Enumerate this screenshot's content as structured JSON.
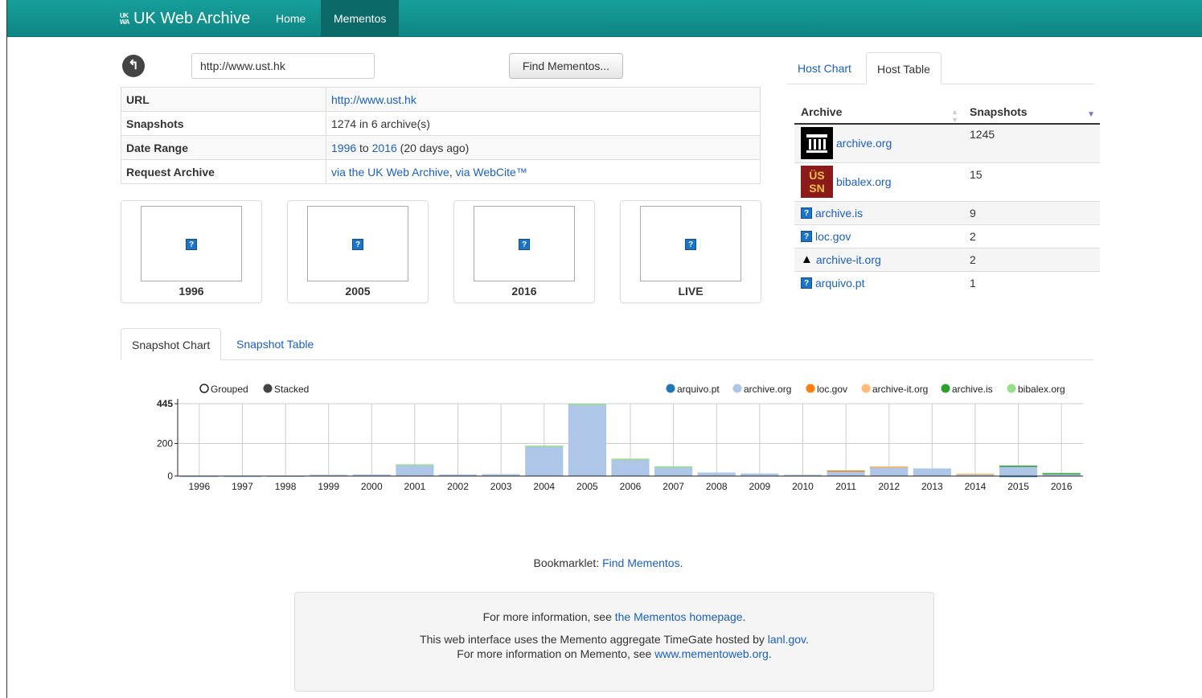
{
  "nav": {
    "brand_logo": "UK WA",
    "brand": "UK Web Archive",
    "home": "Home",
    "mementos": "Mementos"
  },
  "search": {
    "url_value": "http://www.ust.hk",
    "button": "Find Mementos..."
  },
  "info": {
    "url_label": "URL",
    "url_value": "http://www.ust.hk",
    "snapshots_label": "Snapshots",
    "snapshots_value": "1274 in 6 archive(s)",
    "range_label": "Date Range",
    "range_start": "1996",
    "range_mid": " to ",
    "range_end": "2016",
    "range_suffix": " (20 days ago)",
    "request_label": "Request Archive",
    "request_link1": "via the UK Web Archive",
    "request_sep": ", ",
    "request_link2": "via WebCite™"
  },
  "thumbnails": [
    {
      "label": "1996"
    },
    {
      "label": "2005"
    },
    {
      "label": "2016"
    },
    {
      "label": "LIVE"
    }
  ],
  "host_tabs": {
    "chart": "Host Chart",
    "table": "Host Table"
  },
  "host_table": {
    "col_archive": "Archive",
    "col_snapshots": "Snapshots",
    "rows": [
      {
        "name": "archive.org",
        "count": "1245",
        "icon": "archive-org-pillars-icon"
      },
      {
        "name": "bibalex.org",
        "count": "15",
        "icon": "bibalex-logo-icon"
      },
      {
        "name": "archive.is",
        "count": "9",
        "icon": "question-icon"
      },
      {
        "name": "loc.gov",
        "count": "2",
        "icon": "question-icon"
      },
      {
        "name": "archive-it.org",
        "count": "2",
        "icon": "archive-it-triangle-icon"
      },
      {
        "name": "arquivo.pt",
        "count": "1",
        "icon": "question-icon"
      }
    ]
  },
  "snapshot_tabs": {
    "chart": "Snapshot Chart",
    "table": "Snapshot Table"
  },
  "chart_controls": {
    "grouped": "Grouped",
    "stacked": "Stacked"
  },
  "chart_data": {
    "type": "bar",
    "stacked": true,
    "categories": [
      "1996",
      "1997",
      "1998",
      "1999",
      "2000",
      "2001",
      "2002",
      "2003",
      "2004",
      "2005",
      "2006",
      "2007",
      "2008",
      "2009",
      "2010",
      "2011",
      "2012",
      "2013",
      "2014",
      "2015",
      "2016"
    ],
    "series": [
      {
        "name": "arquivo.pt",
        "color": "#1f77b4",
        "values": [
          0,
          0,
          0,
          0,
          0,
          0,
          0,
          0,
          0,
          0,
          0,
          0,
          0,
          0,
          0,
          0,
          0,
          0,
          0,
          1,
          0
        ]
      },
      {
        "name": "archive.org",
        "color": "#aec7e8",
        "values": [
          1,
          1,
          2,
          8,
          10,
          70,
          10,
          12,
          185,
          438,
          105,
          58,
          22,
          16,
          8,
          33,
          58,
          47,
          14,
          60,
          12
        ]
      },
      {
        "name": "loc.gov",
        "color": "#ff7f0e",
        "values": [
          0,
          0,
          0,
          0,
          0,
          0,
          0,
          0,
          0,
          0,
          0,
          0,
          0,
          0,
          0,
          1,
          1,
          0,
          0,
          0,
          0
        ]
      },
      {
        "name": "archive-it.org",
        "color": "#ffbb78",
        "values": [
          0,
          0,
          0,
          0,
          0,
          0,
          0,
          0,
          0,
          0,
          0,
          0,
          0,
          0,
          0,
          0,
          1,
          0,
          1,
          0,
          0
        ]
      },
      {
        "name": "archive.is",
        "color": "#2ca02c",
        "values": [
          0,
          0,
          0,
          0,
          0,
          0,
          0,
          0,
          0,
          0,
          0,
          0,
          0,
          0,
          0,
          0,
          0,
          0,
          0,
          3,
          6
        ]
      },
      {
        "name": "bibalex.org",
        "color": "#98df8a",
        "values": [
          0,
          0,
          0,
          0,
          0,
          2,
          0,
          0,
          2,
          7,
          2,
          2,
          0,
          0,
          0,
          0,
          0,
          0,
          0,
          0,
          0
        ]
      }
    ],
    "yticks": [
      0,
      200,
      445
    ],
    "ylim": [
      0,
      445
    ],
    "grid": true,
    "legend_position": "top-right"
  },
  "footer": {
    "bookmarklet_label": "Bookmarklet: ",
    "bookmarklet_link": "Find Mementos",
    "bookmarklet_end": ".",
    "info1_pre": "For more information, see ",
    "info1_link": "the Mementos homepage",
    "info1_end": ".",
    "info2_pre": "This web interface uses the Memento aggregate TimeGate hosted by ",
    "info2_link": "lanl.gov",
    "info2_end": ".",
    "info3_pre": "For more information on Memento, see ",
    "info3_link": "www.mementoweb.org",
    "info3_end": "."
  }
}
